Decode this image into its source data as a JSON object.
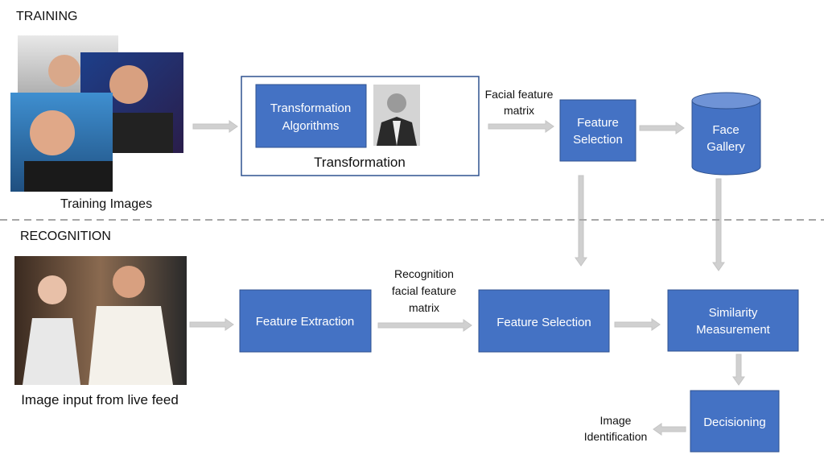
{
  "colors": {
    "box_fill": "#4472C4",
    "box_border": "#2F528F",
    "arrow": "#D0D0D0",
    "divider": "#A6A6A6"
  },
  "training": {
    "section_label": "TRAINING",
    "training_images_label": "Training Images",
    "transformation_label": "Transformation",
    "transformation_algorithms": [
      "Transformation",
      "Algorithms"
    ],
    "facial_feature_matrix": [
      "Facial feature",
      "matrix"
    ],
    "feature_selection": [
      "Feature",
      "Selection"
    ],
    "face_gallery": [
      "Face",
      "Gallery"
    ]
  },
  "recognition": {
    "section_label": "RECOGNITION",
    "input_label": "Image input from live feed",
    "feature_extraction": "Feature Extraction",
    "recognition_matrix": [
      "Recognition",
      "facial feature",
      "matrix"
    ],
    "feature_selection": "Feature Selection",
    "similarity": [
      "Similarity",
      "Measurement"
    ],
    "decisioning": "Decisioning",
    "image_identification": [
      "Image",
      "Identification"
    ]
  }
}
